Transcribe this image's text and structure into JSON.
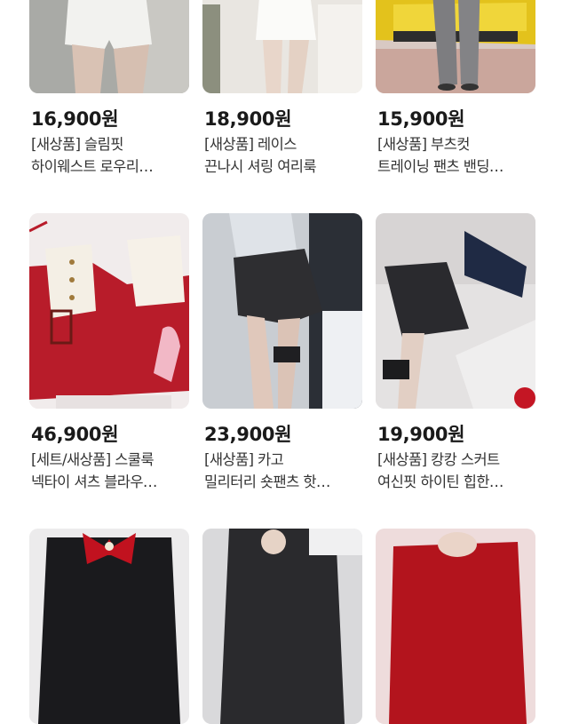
{
  "products": [
    {
      "price": "16,900원",
      "title_line1": "[새상품] 슬림핏",
      "title_line2": "하이웨스트 로우리…",
      "image": "white-shorts-photo"
    },
    {
      "price": "18,900원",
      "title_line1": "[새상품] 레이스",
      "title_line2": "끈나시 셔링 여리룩",
      "image": "white-dress-photo"
    },
    {
      "price": "15,900원",
      "title_line1": "[새상품] 부츠컷",
      "title_line2": "트레이닝 팬츠 밴딩…",
      "image": "grey-pants-yellow-car-photo"
    },
    {
      "price": "46,900원",
      "title_line1": "[세트/새상품] 스쿨룩",
      "title_line2": "넥타이 셔츠 블라우…",
      "image": "red-skirt-set-flatlay-photo"
    },
    {
      "price": "23,900원",
      "title_line1": "[새상품] 카고",
      "title_line2": "밀리터리 숏팬츠 핫…",
      "image": "cargo-shorts-photo"
    },
    {
      "price": "19,900원",
      "title_line1": "[새상품] 캉캉 스커트",
      "title_line2": "여신핏 하이틴 힙한…",
      "image": "black-skirt-photo"
    },
    {
      "price": "",
      "title_line1": "",
      "title_line2": "",
      "image": "black-top-red-bow-photo"
    },
    {
      "price": "",
      "title_line1": "",
      "title_line2": "",
      "image": "dark-outfit-photo"
    },
    {
      "price": "",
      "title_line1": "",
      "title_line2": "",
      "image": "red-top-photo"
    }
  ]
}
